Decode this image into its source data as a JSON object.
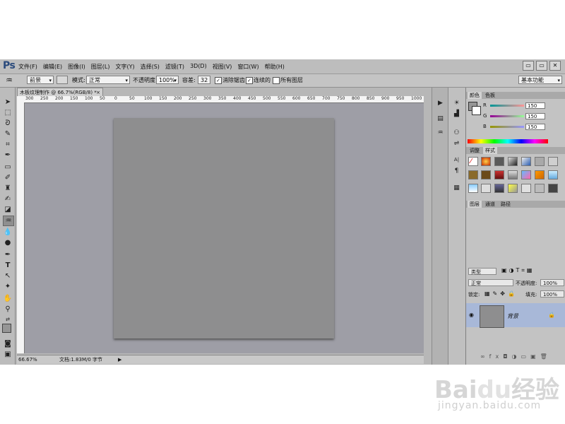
{
  "app": {
    "logo": "Ps"
  },
  "menu": [
    "文件(F)",
    "编辑(E)",
    "图像(I)",
    "图层(L)",
    "文字(Y)",
    "选择(S)",
    "滤镜(T)",
    "3D(D)",
    "视图(V)",
    "窗口(W)",
    "帮助(H)"
  ],
  "window_buttons": [
    "▭",
    "▭",
    "✕"
  ],
  "options": {
    "preset_label": "前景",
    "mode_label": "模式:",
    "mode_value": "正常",
    "opacity_label": "不透明度:",
    "opacity_value": "100%",
    "tolerance_label": "容差:",
    "tolerance_value": "32",
    "antialias_label": "消除锯齿",
    "contiguous_label": "连续的",
    "all_layers_label": "所有图层",
    "workspace": "基本功能"
  },
  "document": {
    "tab_title": "木板纹理制作 @ 66.7%(RGB/8) *",
    "zoom": "66.67%",
    "doc_info": "文档:1.83M/0 字节"
  },
  "ruler_ticks": [
    "300",
    "250",
    "200",
    "150",
    "100",
    "50",
    "0",
    "50",
    "100",
    "150",
    "200",
    "250",
    "300",
    "350",
    "400",
    "450",
    "500",
    "550",
    "600",
    "650",
    "700",
    "750",
    "800",
    "850",
    "900",
    "950",
    "1000"
  ],
  "color_panel": {
    "tabs": [
      "颜色",
      "色板"
    ],
    "channels": [
      {
        "label": "R",
        "value": "150"
      },
      {
        "label": "G",
        "value": "150"
      },
      {
        "label": "B",
        "value": "150"
      }
    ]
  },
  "styles_panel": {
    "tabs": [
      "调整",
      "样式"
    ]
  },
  "layers_panel": {
    "tabs": [
      "图层",
      "通道",
      "路径"
    ],
    "kind": "类型",
    "blend_mode": "正常",
    "opacity_label": "不透明度:",
    "opacity_value": "100%",
    "lock_label": "锁定:",
    "fill_label": "填充:",
    "fill_value": "100%",
    "layer_name": "背景"
  },
  "colors": {
    "chrome": "#b7b7b7",
    "canvas_bg": "#9e9ea6",
    "document": "#8e8e8f",
    "selected_layer": "#a8b8d8",
    "logo": "#2a4a7c"
  },
  "watermark": {
    "main": "Baidu经验",
    "sub": "jingyan.baidu.com"
  }
}
